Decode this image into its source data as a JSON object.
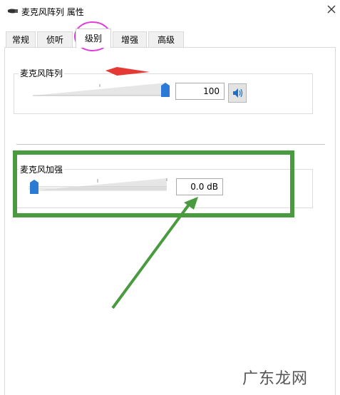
{
  "window": {
    "title": "麦克风阵列 属性",
    "close_symbol": "✕"
  },
  "tabs": [
    {
      "label": "常规",
      "active": false
    },
    {
      "label": "侦听",
      "active": false
    },
    {
      "label": "级别",
      "active": true
    },
    {
      "label": "增强",
      "active": false
    },
    {
      "label": "高级",
      "active": false
    }
  ],
  "levels": {
    "mic_array": {
      "label": "麦克风阵列",
      "value_text": "100",
      "slider_fraction": 1.0
    },
    "mic_boost": {
      "label": "麦克风加强",
      "value_text": "0.0 dB",
      "slider_fraction": 0.0
    }
  },
  "watermark": {
    "text": "广东龙网"
  },
  "colors": {
    "accent_blue": "#2b7bd6",
    "green_annotation": "#4a9b3f",
    "red_arrow": "#e53935",
    "magenta_circle": "#e23bdc"
  }
}
